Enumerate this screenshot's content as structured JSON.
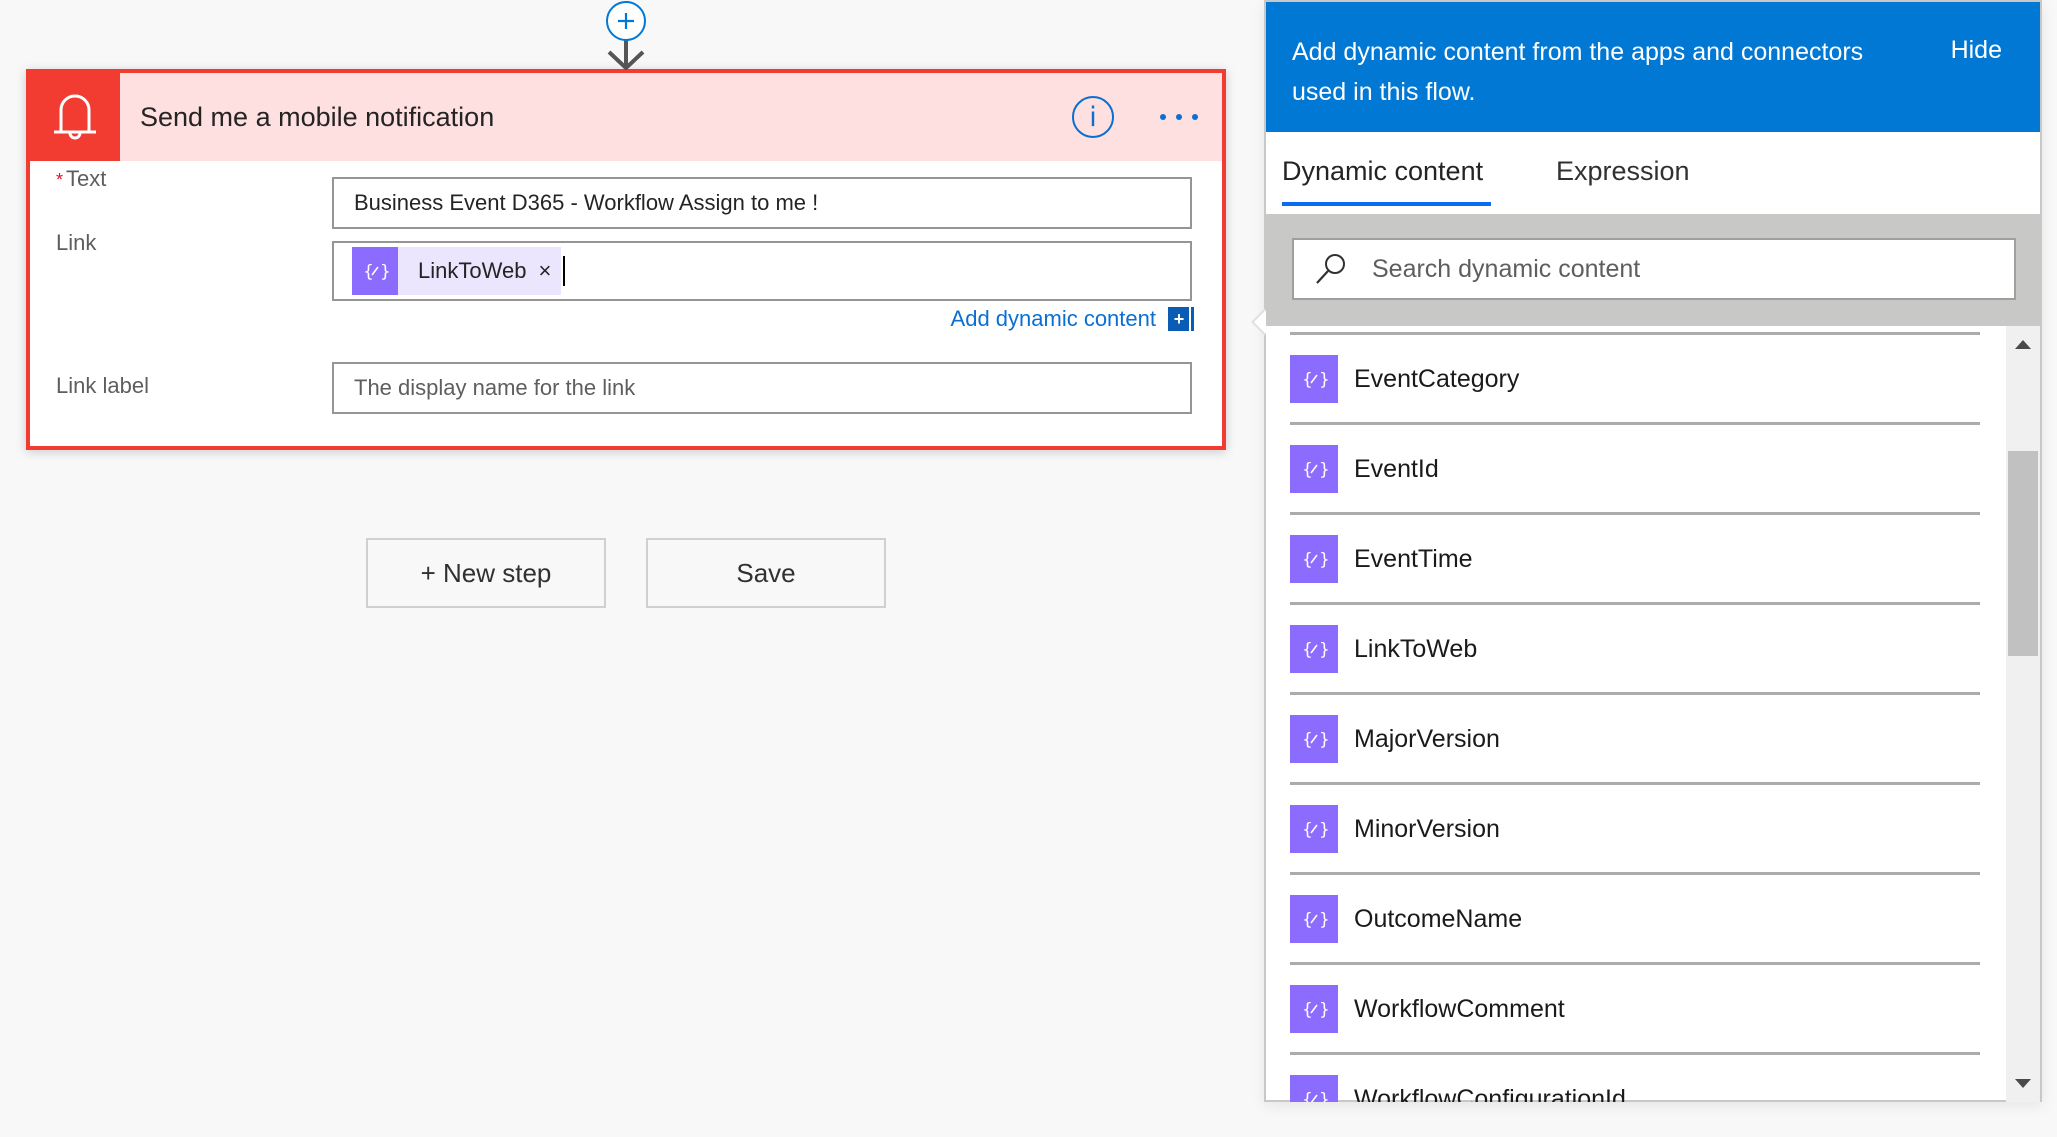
{
  "action_card": {
    "title": "Send me a mobile notification",
    "header_color": "#f23c32",
    "icon": "bell-icon",
    "info_icon": "info-icon",
    "more_icon": "ellipsis-icon",
    "fields": {
      "text": {
        "label": "Text",
        "required_marker": "*",
        "value": "Business Event D365 - Workflow Assign to me !"
      },
      "link": {
        "label": "Link",
        "token": {
          "label": "LinkToWeb",
          "remove": "×"
        }
      },
      "link_label": {
        "label": "Link label",
        "placeholder": "The display name for the link"
      }
    },
    "add_dynamic_content": "Add dynamic content",
    "add_dynamic_icon": "+"
  },
  "buttons": {
    "new_step": "+ New step",
    "save": "Save"
  },
  "dynamic_panel": {
    "header_text": "Add dynamic content from the apps and connectors used in this flow.",
    "hide": "Hide",
    "accent_color": "#0178d4",
    "tabs": [
      {
        "label": "Dynamic content",
        "active": true
      },
      {
        "label": "Expression",
        "active": false
      }
    ],
    "search_placeholder": "Search dynamic content",
    "items": [
      {
        "label": "EventCategory"
      },
      {
        "label": "EventId"
      },
      {
        "label": "EventTime"
      },
      {
        "label": "LinkToWeb"
      },
      {
        "label": "MajorVersion"
      },
      {
        "label": "MinorVersion"
      },
      {
        "label": "OutcomeName"
      },
      {
        "label": "WorkflowComment"
      },
      {
        "label": "WorkflowConfigurationId"
      }
    ]
  }
}
